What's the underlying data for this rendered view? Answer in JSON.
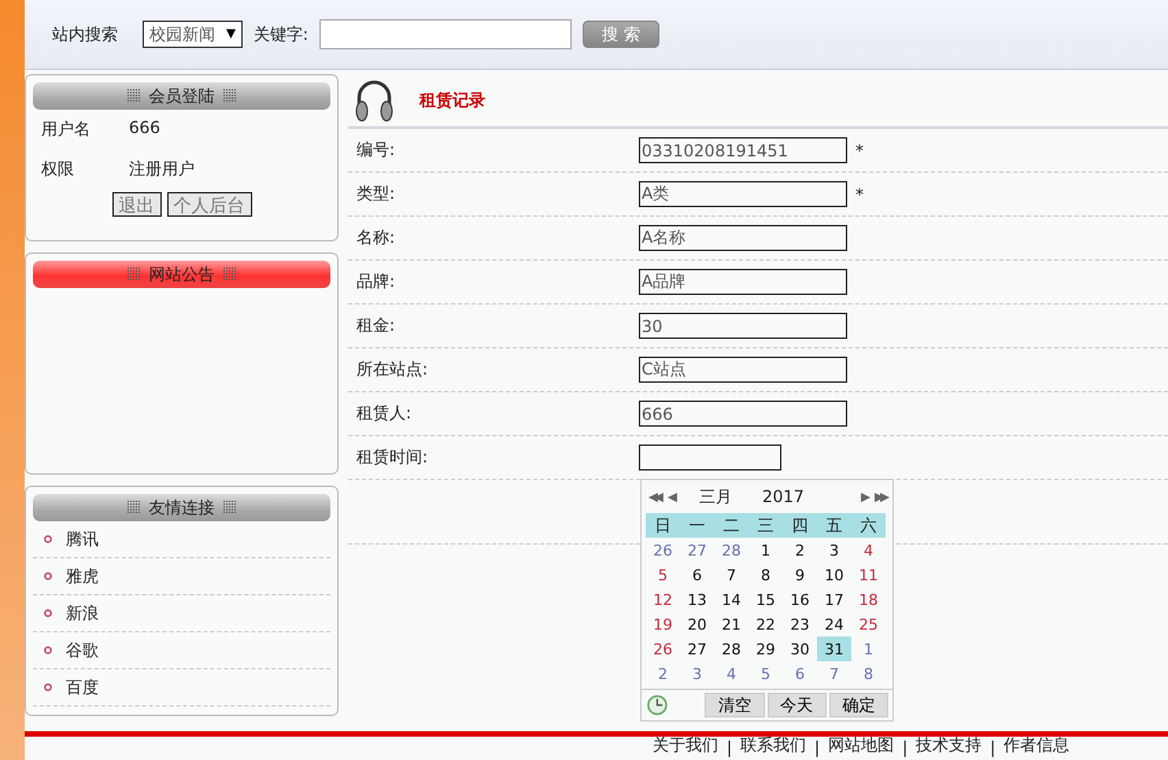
{
  "search": {
    "label": "站内搜索",
    "category": "校园新闻",
    "caret": "▼",
    "keyword_label": "关键字:",
    "button": "搜 索"
  },
  "login": {
    "title": "会员登陆",
    "rows": [
      {
        "label": "用户名",
        "value": "666"
      },
      {
        "label": "权限",
        "value": "注册用户"
      }
    ],
    "buttons": [
      "退出",
      "个人后台"
    ]
  },
  "notice": {
    "title": "网站公告"
  },
  "links": {
    "title": "友情连接",
    "items": [
      "腾讯",
      "雅虎",
      "新浪",
      "谷歌",
      "百度"
    ]
  },
  "form": {
    "title": "租赁记录",
    "required_mark": "*",
    "fields": [
      {
        "label": "编号:",
        "value": "03310208191451",
        "required": true,
        "kind": "text"
      },
      {
        "label": "类型:",
        "value": "A类",
        "required": true,
        "kind": "text"
      },
      {
        "label": "名称:",
        "value": "A名称",
        "required": false,
        "kind": "text"
      },
      {
        "label": "品牌:",
        "value": "A品牌",
        "required": false,
        "kind": "text"
      },
      {
        "label": "租金:",
        "value": "30",
        "required": false,
        "kind": "text"
      },
      {
        "label": "所在站点:",
        "value": "C站点",
        "required": false,
        "kind": "text"
      },
      {
        "label": "租赁人:",
        "value": "666",
        "required": false,
        "kind": "text"
      },
      {
        "label": "租赁时间:",
        "required": false,
        "kind": "date"
      }
    ]
  },
  "calendar": {
    "nav_prev": [
      "◀◀",
      "◀"
    ],
    "month": "三月",
    "year": "2017",
    "nav_next": [
      "▶",
      "▶▶"
    ],
    "weekdays": [
      "日",
      "一",
      "二",
      "三",
      "四",
      "五",
      "六"
    ],
    "weeks": [
      [
        {
          "d": "26",
          "kind": "other",
          "selected": false
        },
        {
          "d": "27",
          "kind": "other",
          "selected": false
        },
        {
          "d": "28",
          "kind": "other",
          "selected": false
        },
        {
          "d": "1",
          "kind": "day",
          "selected": false
        },
        {
          "d": "2",
          "kind": "day",
          "selected": false
        },
        {
          "d": "3",
          "kind": "day",
          "selected": false
        },
        {
          "d": "4",
          "kind": "weekend",
          "selected": false
        }
      ],
      [
        {
          "d": "5",
          "kind": "weekend",
          "selected": false
        },
        {
          "d": "6",
          "kind": "day",
          "selected": false
        },
        {
          "d": "7",
          "kind": "day",
          "selected": false
        },
        {
          "d": "8",
          "kind": "day",
          "selected": false
        },
        {
          "d": "9",
          "kind": "day",
          "selected": false
        },
        {
          "d": "10",
          "kind": "day",
          "selected": false
        },
        {
          "d": "11",
          "kind": "weekend",
          "selected": false
        }
      ],
      [
        {
          "d": "12",
          "kind": "weekend",
          "selected": false
        },
        {
          "d": "13",
          "kind": "day",
          "selected": false
        },
        {
          "d": "14",
          "kind": "day",
          "selected": false
        },
        {
          "d": "15",
          "kind": "day",
          "selected": false
        },
        {
          "d": "16",
          "kind": "day",
          "selected": false
        },
        {
          "d": "17",
          "kind": "day",
          "selected": false
        },
        {
          "d": "18",
          "kind": "weekend",
          "selected": false
        }
      ],
      [
        {
          "d": "19",
          "kind": "weekend",
          "selected": false
        },
        {
          "d": "20",
          "kind": "day",
          "selected": false
        },
        {
          "d": "21",
          "kind": "day",
          "selected": false
        },
        {
          "d": "22",
          "kind": "day",
          "selected": false
        },
        {
          "d": "23",
          "kind": "day",
          "selected": false
        },
        {
          "d": "24",
          "kind": "day",
          "selected": false
        },
        {
          "d": "25",
          "kind": "weekend",
          "selected": false
        }
      ],
      [
        {
          "d": "26",
          "kind": "weekend",
          "selected": false
        },
        {
          "d": "27",
          "kind": "day",
          "selected": false
        },
        {
          "d": "28",
          "kind": "day",
          "selected": false
        },
        {
          "d": "29",
          "kind": "day",
          "selected": false
        },
        {
          "d": "30",
          "kind": "day",
          "selected": false
        },
        {
          "d": "31",
          "kind": "day",
          "selected": true
        },
        {
          "d": "1",
          "kind": "other",
          "selected": false
        }
      ],
      [
        {
          "d": "2",
          "kind": "other",
          "selected": false
        },
        {
          "d": "3",
          "kind": "other",
          "selected": false
        },
        {
          "d": "4",
          "kind": "other",
          "selected": false
        },
        {
          "d": "5",
          "kind": "other",
          "selected": false
        },
        {
          "d": "6",
          "kind": "other",
          "selected": false
        },
        {
          "d": "7",
          "kind": "other",
          "selected": false
        },
        {
          "d": "8",
          "kind": "other",
          "selected": false
        }
      ]
    ],
    "buttons": [
      "清空",
      "今天",
      "确定"
    ]
  },
  "footer": {
    "separator": "|",
    "links": [
      "关于我们",
      "联系我们",
      "网站地图",
      "技术支持",
      "作者信息"
    ]
  }
}
